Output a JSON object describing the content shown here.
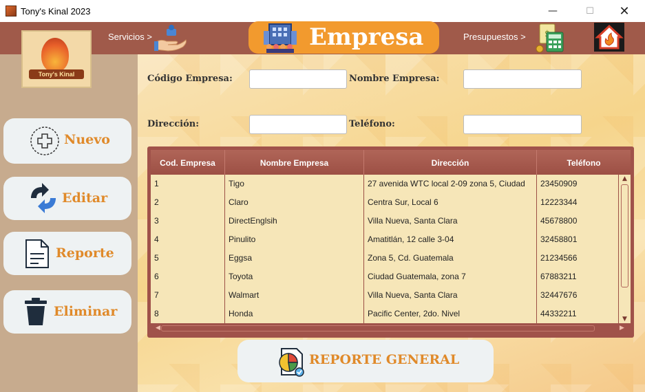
{
  "window": {
    "title": "Tony's Kinal 2023",
    "minimize": "—",
    "maximize": "☐",
    "close": "✕"
  },
  "header": {
    "logo_text": "Tony's Kinal",
    "services_link": "Servicios >",
    "budgets_link": "Presupuestos >",
    "page_title": "Empresa"
  },
  "sidebar": {
    "new_label": "Nuevo",
    "edit_label": "Editar",
    "report_label": "Reporte",
    "delete_label": "Eliminar"
  },
  "form": {
    "code_label": "Código Empresa:",
    "code_value": "",
    "name_label": "Nombre Empresa:",
    "name_value": "",
    "address_label": "Dirección:",
    "address_value": "",
    "phone_label": "Teléfono:",
    "phone_value": ""
  },
  "table": {
    "columns": [
      "Cod. Empresa",
      "Nombre Empresa",
      "Dirección",
      "Teléfono"
    ],
    "rows": [
      [
        "1",
        "Tigo",
        "27 avenida WTC local 2-09 zona 5, Ciudad",
        "23450909"
      ],
      [
        "2",
        "Claro",
        "Centra Sur, Local 6",
        "12223344"
      ],
      [
        "3",
        "DirectEnglsih",
        "Villa Nueva, Santa Clara",
        "45678800"
      ],
      [
        "4",
        "Pinulito",
        "Amatitlán, 12 calle 3-04",
        "32458801"
      ],
      [
        "5",
        "Eggsa",
        "Zona 5, Cd. Guatemala",
        "21234566"
      ],
      [
        "6",
        "Toyota",
        "Ciudad Guatemala, zona 7",
        "67883211"
      ],
      [
        "7",
        "Walmart",
        "Villa Nueva, Santa Clara",
        "32447676"
      ],
      [
        "8",
        "Honda",
        "Pacific Center, 2do. Nivel",
        "44332211"
      ]
    ]
  },
  "footer": {
    "general_report_label": "REPORTE GENERAL"
  },
  "colors": {
    "header": "#a05a4a",
    "accent_orange": "#f29a2e",
    "button_text": "#e08a2a",
    "sidebar": "#c7ab8e",
    "table_frame": "#a0524a",
    "table_body": "#f6e6b8"
  }
}
